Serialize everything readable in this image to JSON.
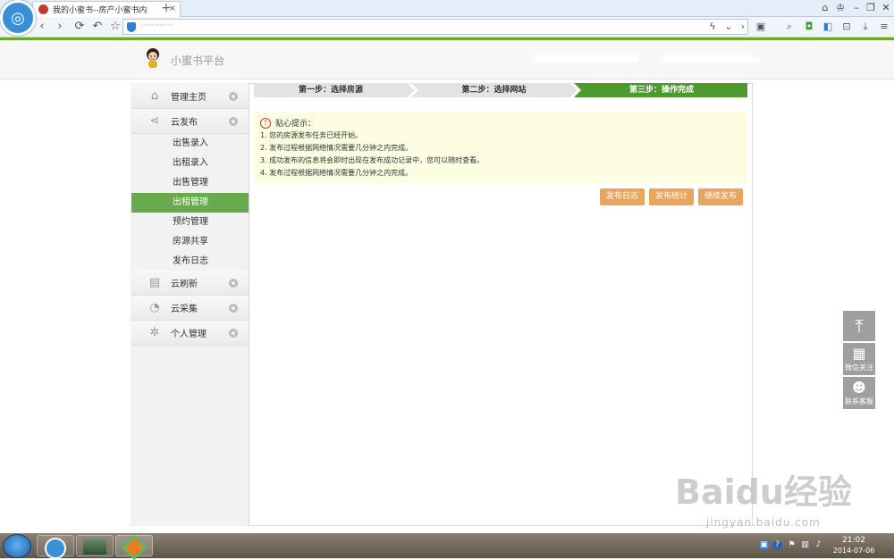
{
  "browser": {
    "tab_title": "我的小蜜书--房产小蜜书内",
    "new_tab": "+",
    "close_tab": "×",
    "address": "·············"
  },
  "header": {
    "site_name": "小蜜书平台"
  },
  "sidebar": {
    "groups": [
      {
        "label": "管理主页",
        "icon": "home-icon"
      },
      {
        "label": "云发布",
        "icon": "share-icon"
      },
      {
        "label": "云刷新",
        "icon": "printer-icon"
      },
      {
        "label": "云采集",
        "icon": "pie-icon"
      },
      {
        "label": "个人管理",
        "icon": "gear-icon"
      }
    ],
    "sub_items": [
      "出售录入",
      "出租录入",
      "出售管理",
      "出租管理",
      "预约管理",
      "房源共享",
      "发布日志"
    ],
    "active_item": "出租管理"
  },
  "steps": [
    "第一步：选择房源",
    "第二步：选择网站",
    "第三步：操作完成"
  ],
  "tips": {
    "title": "贴心提示：",
    "lines": [
      "1. 您的房源发布任务已经开始。",
      "2. 发布过程根据网络情况需要几分钟之内完成。",
      "3. 成功发布的信息将会即时出现在发布成功记录中，您可以随时查看。",
      "4. 发布过程根据网络情况需要几分钟之内完成。"
    ]
  },
  "actions": {
    "log": "发布日志",
    "stats": "发布统计",
    "continue": "继续发布"
  },
  "float": {
    "wechat": "微信关注",
    "service": "联系客服"
  },
  "taskbar": {
    "time": "21:02",
    "date": "2014-07-06"
  },
  "watermark": {
    "main": "Baidu经验",
    "sub": "jingyan.baidu.com"
  },
  "colors": {
    "accent_green": "#6aaa4f",
    "step_green": "#4d9b30",
    "button_orange": "#e9a55b",
    "tips_bg": "#fdfde1"
  }
}
